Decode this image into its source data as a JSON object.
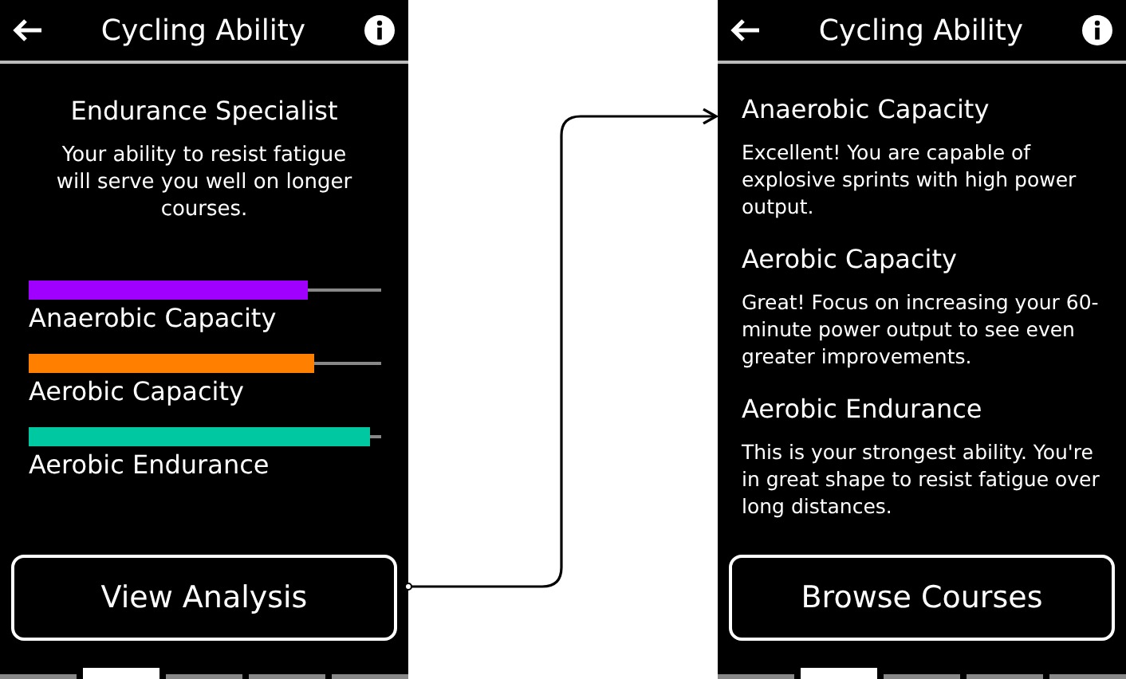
{
  "screens": [
    {
      "kind": "overview",
      "title": "Cycling Ability",
      "heading": "Endurance Specialist",
      "summary": "Your ability to resist fatigue will serve you well on longer courses.",
      "abilities": [
        {
          "name": "Anaerobic Capacity",
          "level": 0.79,
          "color": "#a000ff"
        },
        {
          "name": "Aerobic Capacity",
          "level": 0.81,
          "color": "#ff8000"
        },
        {
          "name": "Aerobic Endurance",
          "level": 0.97,
          "color": "#00c8a0"
        }
      ],
      "button": "View Analysis",
      "pages": [
        {
          "selected": false
        },
        {
          "selected": true
        },
        {
          "selected": false
        },
        {
          "selected": false
        },
        {
          "selected": false
        }
      ]
    },
    {
      "kind": "details",
      "title": "Cycling Ability",
      "sections": [
        {
          "heading": "Anaerobic Capacity",
          "text": "Excellent! You are capable of explosive sprints with high power output."
        },
        {
          "heading": "Aerobic Capacity",
          "text": "Great! Focus on increasing your 60-minute power output to see even greater improvements."
        },
        {
          "heading": "Aerobic Endurance",
          "text": "This is your strongest ability. You're in great shape to resist fatigue over long distances."
        }
      ],
      "button": "Browse Courses",
      "pages": [
        {
          "selected": false
        },
        {
          "selected": true
        },
        {
          "selected": false
        },
        {
          "selected": false
        },
        {
          "selected": false
        }
      ]
    }
  ]
}
